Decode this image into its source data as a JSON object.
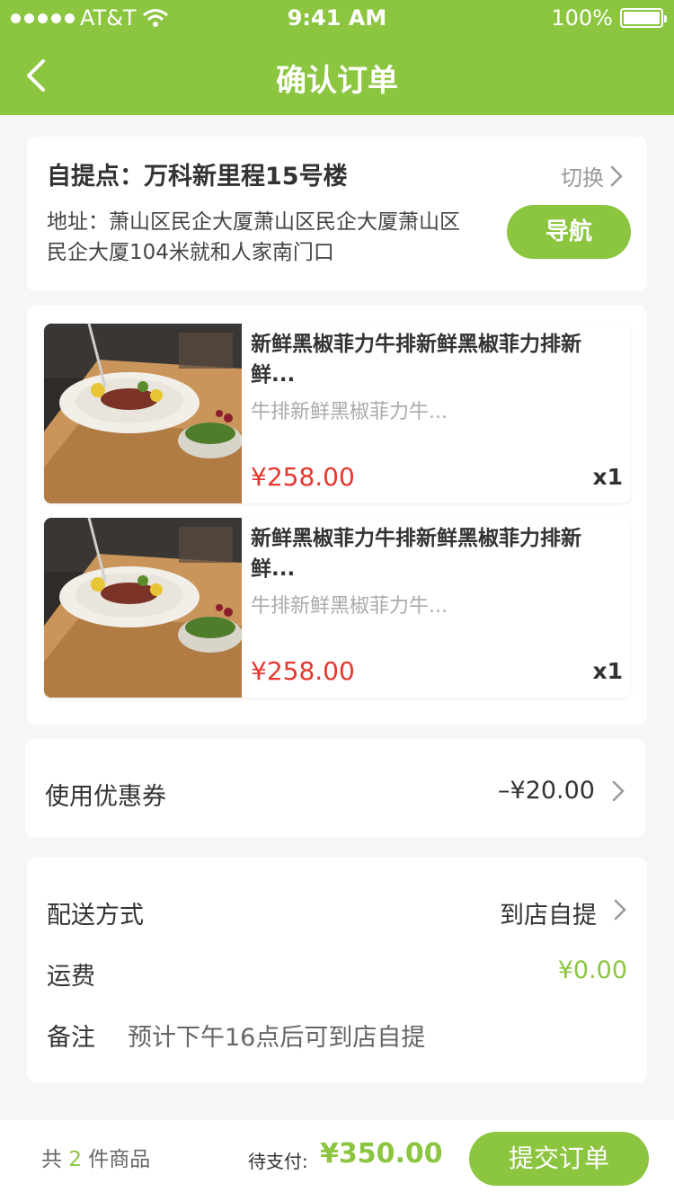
{
  "status_bar": {
    "carrier": "AT&T",
    "time": "9:41 AM",
    "battery_text": "100%"
  },
  "header": {
    "title": "确认订单",
    "back_icon": "chevron-left-icon"
  },
  "pickup": {
    "title": "自提点：万科新里程15号楼",
    "switch_label": "切换",
    "address": "地址：萧山区民企大厦萧山区民企大厦萧山区民企大厦104米就和人家南门口",
    "nav_button": "导航"
  },
  "goods": [
    {
      "name": "新鲜黑椒菲力牛排新鲜黑椒菲力排新鲜...",
      "desc": "牛排新鲜黑椒菲力牛...",
      "price": "¥258.00",
      "qty": "x1"
    },
    {
      "name": "新鲜黑椒菲力牛排新鲜黑椒菲力排新鲜...",
      "desc": "牛排新鲜黑椒菲力牛...",
      "price": "¥258.00",
      "qty": "x1"
    }
  ],
  "coupon": {
    "label": "使用优惠券",
    "value": "–¥20.00"
  },
  "delivery": {
    "method_label": "配送方式",
    "method_value": "到店自提",
    "fee_label": "运费",
    "fee_value": "¥0.00",
    "note_label": "备注",
    "note_value": "预计下午16点后可到店自提"
  },
  "footer": {
    "count_prefix": "共",
    "count": "2",
    "count_suffix": "件商品",
    "pay_label": "待支付:",
    "pay_amount": "¥350.00",
    "submit_label": "提交订单"
  },
  "colors": {
    "brand": "#8cc540",
    "price_red": "#e8362c"
  }
}
